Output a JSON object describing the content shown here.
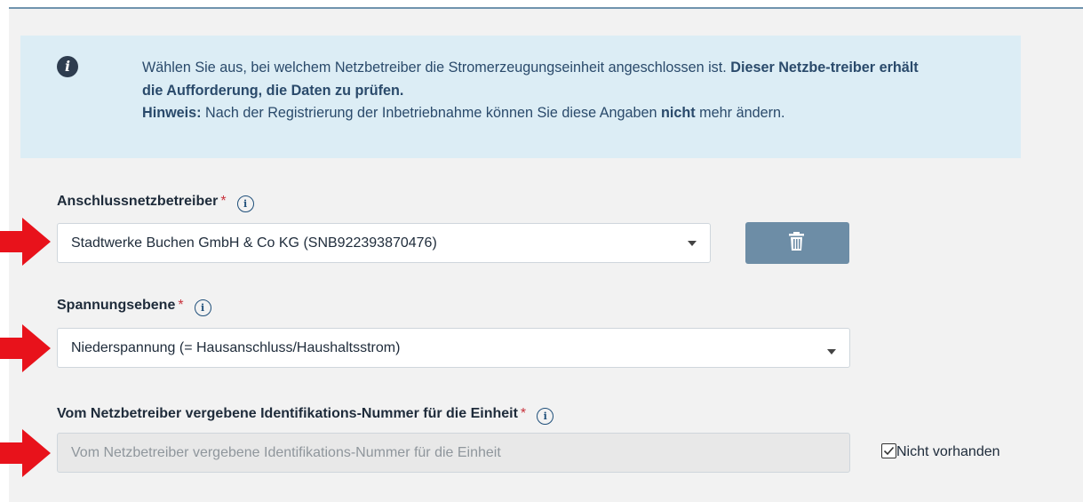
{
  "info": {
    "line1_part1": "Wählen Sie aus, bei welchem Netzbetreiber die Stromerzeugungseinheit angeschlossen ist. ",
    "line1_bold": "Dieser Netzbe-treiber erhält die Aufforderung, die Daten zu prüfen.",
    "hint_label": "Hinweis:",
    "hint_text1": " Nach der Registrierung der Inbetriebnahme können Sie diese Angaben ",
    "hint_bold": "nicht",
    "hint_text2": " mehr ändern."
  },
  "fields": {
    "operator": {
      "label": "Anschlussnetzbetreiber",
      "required_mark": "*",
      "value": "Stadtwerke Buchen GmbH & Co KG (SNB922393870476)"
    },
    "voltage": {
      "label": "Spannungsebene",
      "required_mark": "*",
      "value": "Niederspannung (= Hausanschluss/Haushaltsstrom)"
    },
    "id_number": {
      "label": "Vom Netzbetreiber vergebene Identifikations-Nummer für die Einheit",
      "required_mark": "*",
      "placeholder": "Vom Netzbetreiber vergebene Identifikations-Nummer für die Einheit",
      "not_available_label": "Nicht vorhanden",
      "not_available_checked": true
    }
  },
  "icons": {
    "info": "info-icon",
    "help": "help-icon",
    "delete": "trash-icon",
    "caret": "caret-down-icon",
    "annotation": "red-arrow-icon"
  },
  "colors": {
    "info_bg": "#dcedf5",
    "accent": "#6d8da6",
    "required": "#c8323c",
    "annotation_arrow": "#e8121b"
  }
}
